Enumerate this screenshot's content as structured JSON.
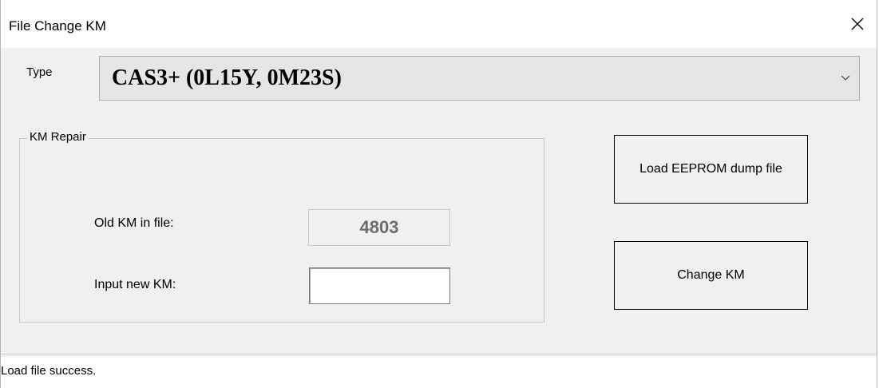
{
  "window": {
    "title": "File Change KM",
    "close_icon": "close-icon"
  },
  "type": {
    "label": "Type",
    "selected": "CAS3+ (0L15Y, 0M23S)",
    "arrow_icon": "chevron-down-icon"
  },
  "km_repair": {
    "legend": "KM Repair",
    "old_km_label": "Old KM in file:",
    "old_km_value": "4803",
    "new_km_label": "Input new KM:",
    "new_km_value": ""
  },
  "buttons": {
    "load_label": "Load EEPROM dump file",
    "change_label": "Change KM"
  },
  "status": {
    "text": "Load file success."
  },
  "colors": {
    "window_bg": "#f0f0f0",
    "combo_bg": "#e5e5e5",
    "readonly_text": "#6d6d6d"
  }
}
